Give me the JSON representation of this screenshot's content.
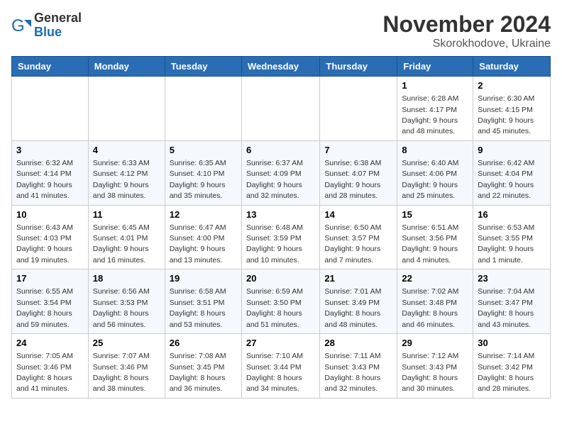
{
  "header": {
    "logo": {
      "general": "General",
      "blue": "Blue"
    },
    "title": "November 2024",
    "location": "Skorokhodove, Ukraine"
  },
  "weekdays": [
    "Sunday",
    "Monday",
    "Tuesday",
    "Wednesday",
    "Thursday",
    "Friday",
    "Saturday"
  ],
  "weeks": [
    [
      null,
      null,
      null,
      null,
      null,
      {
        "day": "1",
        "sunrise": "Sunrise: 6:28 AM",
        "sunset": "Sunset: 4:17 PM",
        "daylight": "Daylight: 9 hours and 48 minutes."
      },
      {
        "day": "2",
        "sunrise": "Sunrise: 6:30 AM",
        "sunset": "Sunset: 4:15 PM",
        "daylight": "Daylight: 9 hours and 45 minutes."
      }
    ],
    [
      {
        "day": "3",
        "sunrise": "Sunrise: 6:32 AM",
        "sunset": "Sunset: 4:14 PM",
        "daylight": "Daylight: 9 hours and 41 minutes."
      },
      {
        "day": "4",
        "sunrise": "Sunrise: 6:33 AM",
        "sunset": "Sunset: 4:12 PM",
        "daylight": "Daylight: 9 hours and 38 minutes."
      },
      {
        "day": "5",
        "sunrise": "Sunrise: 6:35 AM",
        "sunset": "Sunset: 4:10 PM",
        "daylight": "Daylight: 9 hours and 35 minutes."
      },
      {
        "day": "6",
        "sunrise": "Sunrise: 6:37 AM",
        "sunset": "Sunset: 4:09 PM",
        "daylight": "Daylight: 9 hours and 32 minutes."
      },
      {
        "day": "7",
        "sunrise": "Sunrise: 6:38 AM",
        "sunset": "Sunset: 4:07 PM",
        "daylight": "Daylight: 9 hours and 28 minutes."
      },
      {
        "day": "8",
        "sunrise": "Sunrise: 6:40 AM",
        "sunset": "Sunset: 4:06 PM",
        "daylight": "Daylight: 9 hours and 25 minutes."
      },
      {
        "day": "9",
        "sunrise": "Sunrise: 6:42 AM",
        "sunset": "Sunset: 4:04 PM",
        "daylight": "Daylight: 9 hours and 22 minutes."
      }
    ],
    [
      {
        "day": "10",
        "sunrise": "Sunrise: 6:43 AM",
        "sunset": "Sunset: 4:03 PM",
        "daylight": "Daylight: 9 hours and 19 minutes."
      },
      {
        "day": "11",
        "sunrise": "Sunrise: 6:45 AM",
        "sunset": "Sunset: 4:01 PM",
        "daylight": "Daylight: 9 hours and 16 minutes."
      },
      {
        "day": "12",
        "sunrise": "Sunrise: 6:47 AM",
        "sunset": "Sunset: 4:00 PM",
        "daylight": "Daylight: 9 hours and 13 minutes."
      },
      {
        "day": "13",
        "sunrise": "Sunrise: 6:48 AM",
        "sunset": "Sunset: 3:59 PM",
        "daylight": "Daylight: 9 hours and 10 minutes."
      },
      {
        "day": "14",
        "sunrise": "Sunrise: 6:50 AM",
        "sunset": "Sunset: 3:57 PM",
        "daylight": "Daylight: 9 hours and 7 minutes."
      },
      {
        "day": "15",
        "sunrise": "Sunrise: 6:51 AM",
        "sunset": "Sunset: 3:56 PM",
        "daylight": "Daylight: 9 hours and 4 minutes."
      },
      {
        "day": "16",
        "sunrise": "Sunrise: 6:53 AM",
        "sunset": "Sunset: 3:55 PM",
        "daylight": "Daylight: 9 hours and 1 minute."
      }
    ],
    [
      {
        "day": "17",
        "sunrise": "Sunrise: 6:55 AM",
        "sunset": "Sunset: 3:54 PM",
        "daylight": "Daylight: 8 hours and 59 minutes."
      },
      {
        "day": "18",
        "sunrise": "Sunrise: 6:56 AM",
        "sunset": "Sunset: 3:53 PM",
        "daylight": "Daylight: 8 hours and 56 minutes."
      },
      {
        "day": "19",
        "sunrise": "Sunrise: 6:58 AM",
        "sunset": "Sunset: 3:51 PM",
        "daylight": "Daylight: 8 hours and 53 minutes."
      },
      {
        "day": "20",
        "sunrise": "Sunrise: 6:59 AM",
        "sunset": "Sunset: 3:50 PM",
        "daylight": "Daylight: 8 hours and 51 minutes."
      },
      {
        "day": "21",
        "sunrise": "Sunrise: 7:01 AM",
        "sunset": "Sunset: 3:49 PM",
        "daylight": "Daylight: 8 hours and 48 minutes."
      },
      {
        "day": "22",
        "sunrise": "Sunrise: 7:02 AM",
        "sunset": "Sunset: 3:48 PM",
        "daylight": "Daylight: 8 hours and 46 minutes."
      },
      {
        "day": "23",
        "sunrise": "Sunrise: 7:04 AM",
        "sunset": "Sunset: 3:47 PM",
        "daylight": "Daylight: 8 hours and 43 minutes."
      }
    ],
    [
      {
        "day": "24",
        "sunrise": "Sunrise: 7:05 AM",
        "sunset": "Sunset: 3:46 PM",
        "daylight": "Daylight: 8 hours and 41 minutes."
      },
      {
        "day": "25",
        "sunrise": "Sunrise: 7:07 AM",
        "sunset": "Sunset: 3:46 PM",
        "daylight": "Daylight: 8 hours and 38 minutes."
      },
      {
        "day": "26",
        "sunrise": "Sunrise: 7:08 AM",
        "sunset": "Sunset: 3:45 PM",
        "daylight": "Daylight: 8 hours and 36 minutes."
      },
      {
        "day": "27",
        "sunrise": "Sunrise: 7:10 AM",
        "sunset": "Sunset: 3:44 PM",
        "daylight": "Daylight: 8 hours and 34 minutes."
      },
      {
        "day": "28",
        "sunrise": "Sunrise: 7:11 AM",
        "sunset": "Sunset: 3:43 PM",
        "daylight": "Daylight: 8 hours and 32 minutes."
      },
      {
        "day": "29",
        "sunrise": "Sunrise: 7:12 AM",
        "sunset": "Sunset: 3:43 PM",
        "daylight": "Daylight: 8 hours and 30 minutes."
      },
      {
        "day": "30",
        "sunrise": "Sunrise: 7:14 AM",
        "sunset": "Sunset: 3:42 PM",
        "daylight": "Daylight: 8 hours and 28 minutes."
      }
    ]
  ]
}
